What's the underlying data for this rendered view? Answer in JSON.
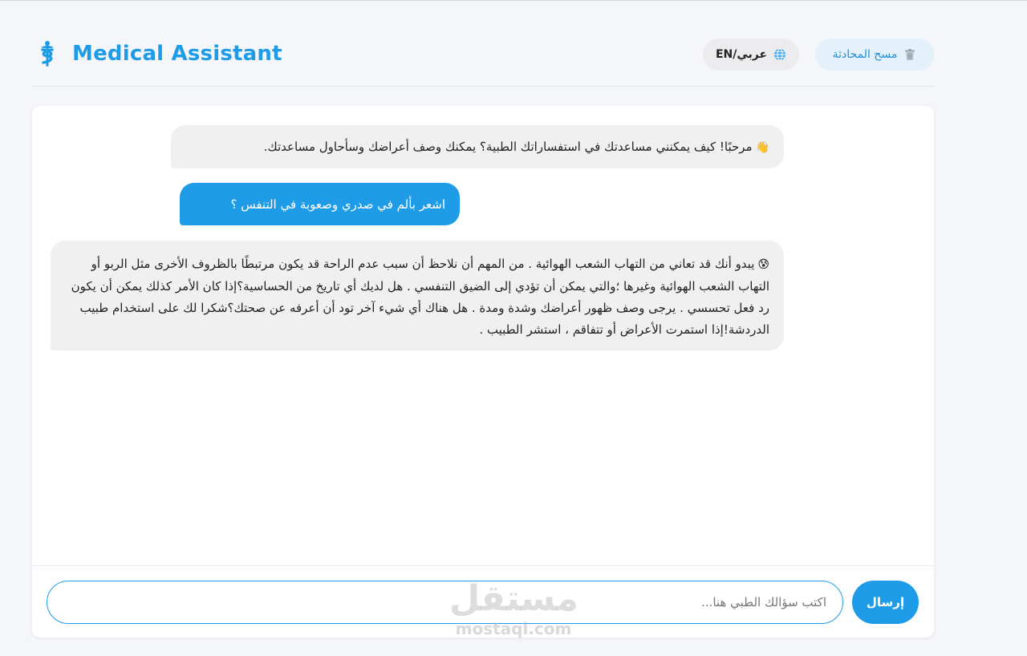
{
  "header": {
    "title": "Medical Assistant",
    "clear_label": "مسح المحادثة",
    "lang_label": "EN/عربي"
  },
  "messages": [
    {
      "role": "bot",
      "emoji": "👋",
      "text": "مرحبًا! كيف يمكنني مساعدتك في استفساراتك الطبية؟ يمكنك وصف أعراضك وسأحاول مساعدتك."
    },
    {
      "role": "user",
      "emoji": "",
      "text": "اشعر بألم في صدري وصعوبة في التنفس ؟"
    },
    {
      "role": "bot",
      "emoji": "😰",
      "text": "يبدو أنك قد تعاني من التهاب الشعب الهوائية . من المهم أن نلاحظ أن سبب عدم الراحة قد يكون مرتبطًا بالظروف الأخرى مثل الربو أو التهاب الشعب الهوائية وغيرها ؛والتي يمكن أن تؤدي إلى الضيق التنفسي . هل لديك أي تاريخ من الحساسية؟إذا كان الأمر كذلك يمكن أن يكون رد فعل تحسسي . يرجى وصف ظهور أعراضك وشدة ومدة . هل هناك أي شيء آخر تود أن أعرفه عن صحتك؟شكرا لك على استخدام طبيب الدردشة!إذا استمرت الأعراض أو تتفاقم ، استشر الطبيب ."
    }
  ],
  "input": {
    "placeholder": "اكتب سؤالك الطبي هنا...",
    "send_label": "إرسال"
  },
  "watermark": {
    "ar": "مستقل",
    "en": "mostaql.com"
  },
  "colors": {
    "accent": "#1f9ce8",
    "bot_bubble": "#f0f0f0",
    "background": "#f5f6fa"
  }
}
